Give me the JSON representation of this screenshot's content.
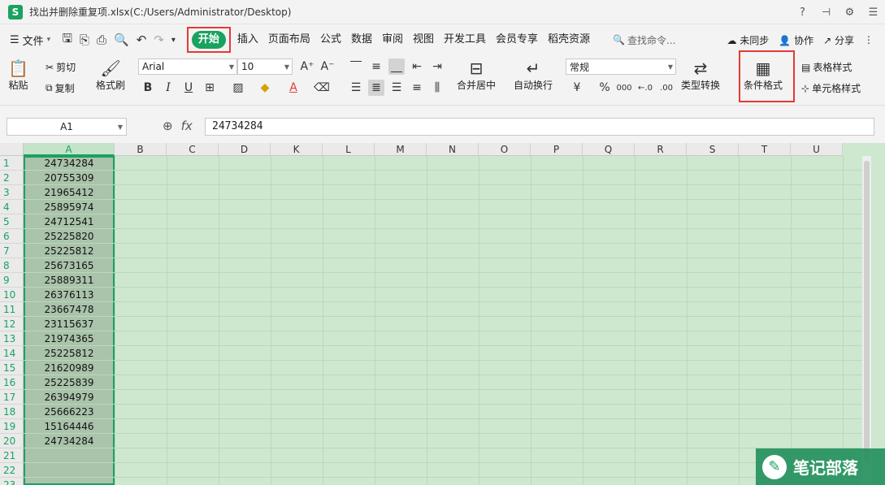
{
  "window": {
    "app_logo": "S",
    "title": "找出并删除重复项.xlsx(C:/Users/Administrator/Desktop)",
    "buttons": [
      "?",
      "⊣",
      "⚙",
      "☰"
    ]
  },
  "menubar": {
    "file_label": "文件",
    "tabs": [
      {
        "label": "开始",
        "active": true
      },
      {
        "label": "插入"
      },
      {
        "label": "页面布局"
      },
      {
        "label": "公式"
      },
      {
        "label": "数据"
      },
      {
        "label": "审阅"
      },
      {
        "label": "视图"
      },
      {
        "label": "开发工具"
      },
      {
        "label": "会员专享"
      },
      {
        "label": "稻壳资源"
      }
    ],
    "search_label": "查找命令...",
    "unsync_label": "未同步",
    "collab_label": "协作",
    "share_label": "分享"
  },
  "ribbon": {
    "paste": "粘贴",
    "cut": "剪切",
    "copy": "复制",
    "format_painter": "格式刷",
    "font_name": "Arial",
    "font_size": "10",
    "merge_center": "合并居中",
    "wrap_text": "自动换行",
    "number_format": "常规",
    "type_convert": "类型转换",
    "conditional_format": "条件格式",
    "table_style": "表格样式",
    "cell_style": "单元格样式",
    "bold": "B",
    "italic": "I",
    "underline": "U",
    "currency": "¥",
    "percent": "%",
    "thousands": "000"
  },
  "formula_bar": {
    "name_box": "A1",
    "fx": "fx",
    "value": "24734284"
  },
  "sheet": {
    "columns": [
      "A",
      "B",
      "C",
      "D",
      "K",
      "L",
      "M",
      "N",
      "O",
      "P",
      "Q",
      "R",
      "S",
      "T",
      "U"
    ],
    "rows": [
      "1",
      "2",
      "3",
      "4",
      "5",
      "6",
      "7",
      "8",
      "9",
      "10",
      "11",
      "12",
      "13",
      "14",
      "15",
      "16",
      "17",
      "18",
      "19",
      "20",
      "21",
      "22",
      "23"
    ],
    "colA_values": [
      "24734284",
      "20755309",
      "21965412",
      "25895974",
      "24712541",
      "25225820",
      "25225812",
      "25673165",
      "25889311",
      "26376113",
      "23667478",
      "23115637",
      "21974365",
      "25225812",
      "21620989",
      "25225839",
      "26394979",
      "25666223",
      "15164446",
      "24734284"
    ]
  },
  "watermark": {
    "text": "笔记部落"
  }
}
